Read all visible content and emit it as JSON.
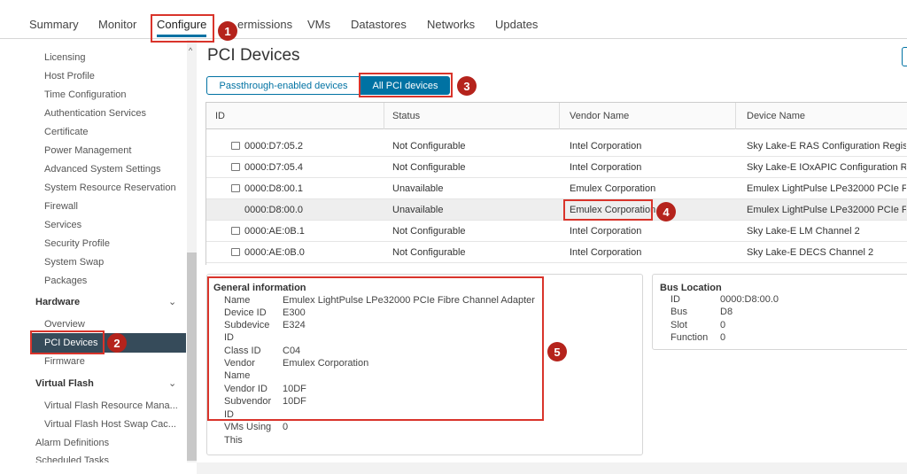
{
  "top_tabs": [
    {
      "label": "Summary"
    },
    {
      "label": "Monitor"
    },
    {
      "label": "Configure"
    },
    {
      "label": "ermissions"
    },
    {
      "label": "VMs"
    },
    {
      "label": "Datastores"
    },
    {
      "label": "Networks"
    },
    {
      "label": "Updates"
    }
  ],
  "sidebar": {
    "items": [
      {
        "label": "Licensing"
      },
      {
        "label": "Host Profile"
      },
      {
        "label": "Time Configuration"
      },
      {
        "label": "Authentication Services"
      },
      {
        "label": "Certificate"
      },
      {
        "label": "Power Management"
      },
      {
        "label": "Advanced System Settings"
      },
      {
        "label": "System Resource Reservation"
      },
      {
        "label": "Firewall"
      },
      {
        "label": "Services"
      },
      {
        "label": "Security Profile"
      },
      {
        "label": "System Swap"
      },
      {
        "label": "Packages"
      }
    ],
    "hardware": {
      "title": "Hardware",
      "items": [
        {
          "label": "Overview"
        },
        {
          "label": "PCI Devices"
        },
        {
          "label": "Firmware"
        }
      ]
    },
    "virtual_flash": {
      "title": "Virtual Flash",
      "items": [
        {
          "label": "Virtual Flash Resource Mana..."
        },
        {
          "label": "Virtual Flash Host Swap Cac..."
        }
      ]
    },
    "footer_items": [
      {
        "label": "Alarm Definitions"
      },
      {
        "label": "Scheduled Tasks"
      }
    ]
  },
  "main": {
    "title": "PCI Devices",
    "filter_passthrough": "Passthrough-enabled devices",
    "filter_all": "All PCI devices",
    "table": {
      "headers": [
        "ID",
        "Status",
        "Vendor Name",
        "Device Name"
      ],
      "rows": [
        {
          "id": "0000:D7:05.2",
          "status": "Not Configurable",
          "vendor": "Intel Corporation",
          "device": "Sky Lake-E RAS Configuration Regist..."
        },
        {
          "id": "0000:D7:05.4",
          "status": "Not Configurable",
          "vendor": "Intel Corporation",
          "device": "Sky Lake-E IOxAPIC Configuration Re..."
        },
        {
          "id": "0000:D8:00.1",
          "status": "Unavailable",
          "vendor": "Emulex Corporation",
          "device": "Emulex LightPulse LPe32000 PCIe Fi..."
        },
        {
          "id": "0000:D8:00.0",
          "status": "Unavailable",
          "vendor": "Emulex Corporation",
          "device": "Emulex LightPulse LPe32000 PCIe Fi..."
        },
        {
          "id": "0000:AE:0B.1",
          "status": "Not Configurable",
          "vendor": "Intel Corporation",
          "device": "Sky Lake-E LM Channel 2"
        },
        {
          "id": "0000:AE:0B.0",
          "status": "Not Configurable",
          "vendor": "Intel Corporation",
          "device": "Sky Lake-E DECS Channel 2"
        }
      ]
    },
    "general_info": {
      "title": "General information",
      "fields": [
        {
          "key": "Name",
          "value": "Emulex LightPulse LPe32000 PCIe Fibre Channel Adapter"
        },
        {
          "key": "Device ID",
          "value": "E300"
        },
        {
          "key": "Subdevice",
          "value": "E324"
        },
        {
          "key": "ID",
          "value": ""
        },
        {
          "key": "Class ID",
          "value": "C04"
        },
        {
          "key": "Vendor",
          "value": "Emulex Corporation"
        },
        {
          "key": "Name",
          "value": ""
        },
        {
          "key": "Vendor ID",
          "value": "10DF"
        },
        {
          "key": "Subvendor",
          "value": "10DF"
        },
        {
          "key": "ID",
          "value": ""
        },
        {
          "key": "VMs Using",
          "value": "0"
        },
        {
          "key": "This",
          "value": ""
        }
      ]
    },
    "bus_location": {
      "title": "Bus Location",
      "fields": [
        {
          "key": "ID",
          "value": "0000:D8:00.0"
        },
        {
          "key": "Bus",
          "value": "D8"
        },
        {
          "key": "Slot",
          "value": "0"
        },
        {
          "key": "Function",
          "value": "0"
        }
      ]
    }
  },
  "callouts": [
    "1",
    "2",
    "3",
    "4",
    "5"
  ],
  "colors": {
    "accent": "#0072a3",
    "selected_nav": "#364b5a",
    "callout_red": "#d9342b",
    "badge_red": "#b5231c"
  }
}
